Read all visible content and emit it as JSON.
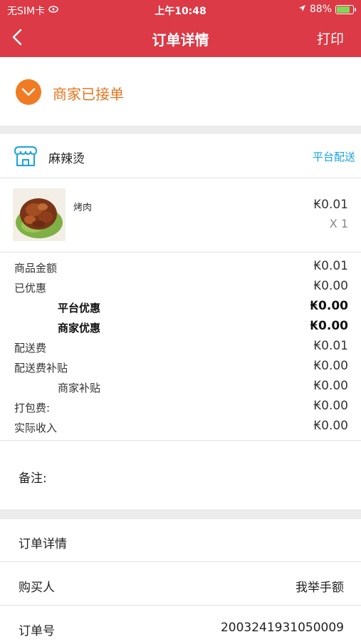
{
  "status_bar": {
    "carrier": "无SIM卡",
    "time": "上午10:48",
    "battery": "88%",
    "battery_level": 0.88
  },
  "nav": {
    "title": "订单详情",
    "print": "打印"
  },
  "order_status": {
    "text": "商家已接单",
    "color": "#f07b22"
  },
  "store": {
    "name": "麻辣烫",
    "delivery": "平台配送"
  },
  "item": {
    "name": "烤肉",
    "price": "₭0.01",
    "quantity": "X 1"
  },
  "fees": [
    {
      "label": "商品金额",
      "value": "₭0.01"
    },
    {
      "label": "已优惠",
      "value": "₭0.00"
    },
    {
      "label": "平台优惠",
      "value": "₭0.00"
    },
    {
      "label": "商家优惠",
      "value": "₭0.00"
    },
    {
      "label": "配送费",
      "value": "₭0.01"
    },
    {
      "label": "配送费补贴",
      "value": "₭0.00"
    },
    {
      "label": "商家补贴",
      "value": "₭0.00"
    },
    {
      "label": "打包费:",
      "value": "₭0.00"
    },
    {
      "label": "实际收入",
      "value": "₭0.00"
    }
  ],
  "remark": {
    "label": "备注:"
  },
  "details": {
    "header": "订单详情",
    "buyer_label": "购买人",
    "buyer_value": "我举手额",
    "order_no_label": "订单号",
    "order_no_value": "2003241931050009"
  },
  "colors": {
    "header": "#dc3a46",
    "accent_orange": "#f07b22",
    "link_blue": "#1aa3e0"
  }
}
